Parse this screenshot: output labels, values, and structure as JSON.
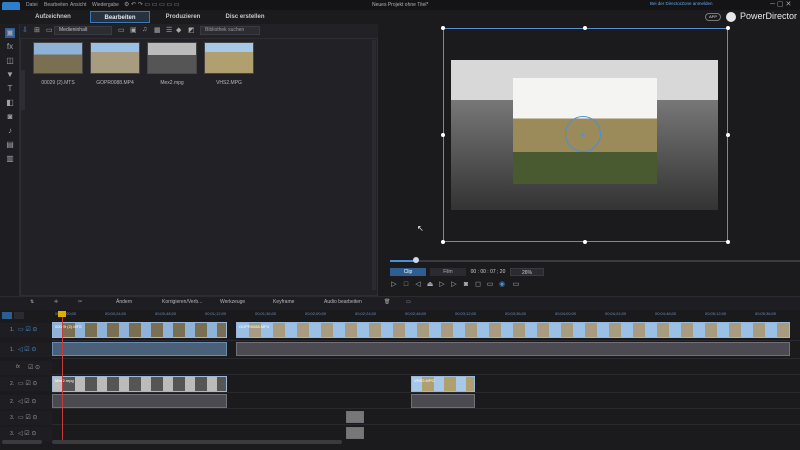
{
  "window": {
    "title": "Neues Projekt ohne Titel*",
    "notify": "Bei der DirectorZone anmelden",
    "brand": "PowerDirector",
    "app_badge": "APP"
  },
  "menu": [
    "Datei",
    "Bearbeiten",
    "Ansicht",
    "Wiedergabe"
  ],
  "top_tabs": [
    {
      "label": "Aufzeichnen",
      "active": false
    },
    {
      "label": "Bearbeiten",
      "active": true
    },
    {
      "label": "Produzieren",
      "active": false
    },
    {
      "label": "Disc erstellen",
      "active": false
    }
  ],
  "media": {
    "dropdown": "Medieninhalt",
    "search_placeholder": "Bibliothek suchen",
    "items": [
      {
        "name": "00029 (2).MTS"
      },
      {
        "name": "GOPR0088.MP4"
      },
      {
        "name": "Mex2.mpg"
      },
      {
        "name": "VHS2.MPG"
      }
    ]
  },
  "preview": {
    "tab_clip": "Clip",
    "tab_film": "Film",
    "timecode": "00 : 00 : 07 ; 20",
    "zoom": "26%"
  },
  "timeline_toolbar": {
    "andern": "Ändern",
    "korrigieren": "Korrigieren/Verb...",
    "werkzeuge": "Werkzeuge",
    "keyframe": "Keyframe",
    "audio": "Audio bearbeiten"
  },
  "ruler": [
    "00;00;00;00",
    "00;00;24;00",
    "00;00;48;00",
    "00;01;12;00",
    "00;01;36;00",
    "00;02;00;00",
    "00;02;24;00",
    "00;02;48;00",
    "00;03;12;00",
    "00;03;36;00",
    "00;04;00;00",
    "00;04;24;00",
    "00;04;48;00",
    "00;05;12;00",
    "00;05;36;00"
  ],
  "tracks": {
    "v1": "1.",
    "a1": "1.",
    "fx": "fx",
    "v2": "2.",
    "a2": "2.",
    "v3": "3.",
    "a3": "3."
  },
  "clips": {
    "v1a": "00029 (2).MTS",
    "v1b": "GOPR0088.MP4",
    "v2a": "Mex2.mpg",
    "v2b": "VHS2.MPG"
  }
}
